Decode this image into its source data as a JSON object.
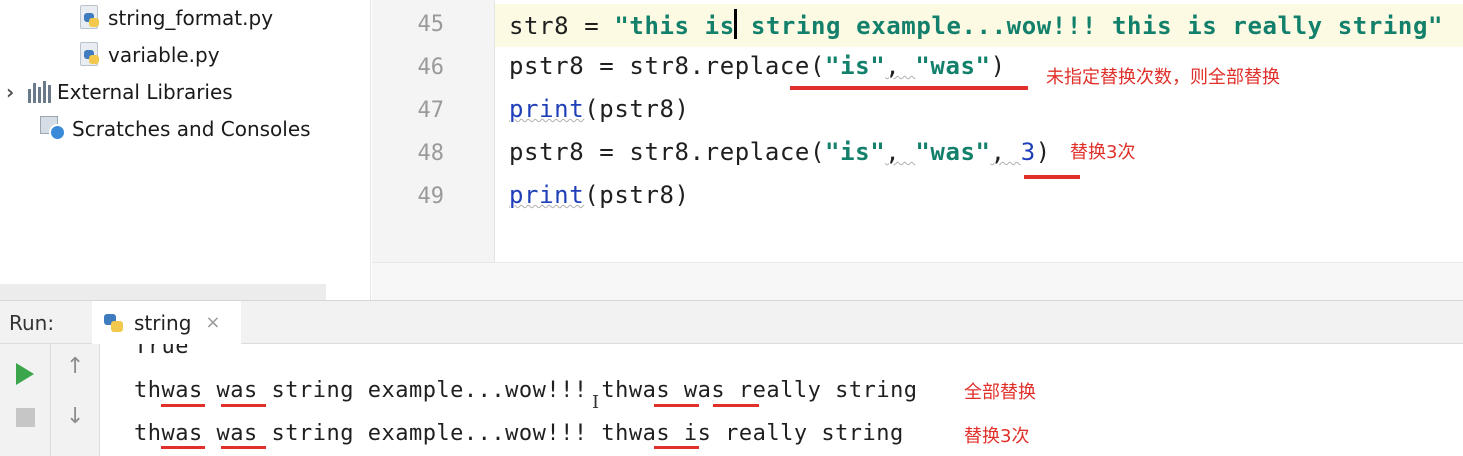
{
  "project_tree": {
    "items": [
      {
        "label": "string_format.py",
        "icon": "python-file-icon"
      },
      {
        "label": "variable.py",
        "icon": "python-file-icon"
      },
      {
        "label": "External Libraries",
        "icon": "library-icon",
        "expander": "›"
      },
      {
        "label": "Scratches and Consoles",
        "icon": "scratches-icon"
      }
    ]
  },
  "editor": {
    "line_numbers": [
      "45",
      "46",
      "47",
      "48",
      "49"
    ],
    "lines": {
      "l45": {
        "a": "str8 = ",
        "b": "\"this is",
        "c": " string example...wow!!! this is really string\""
      },
      "l46": {
        "a": "pstr8 = str8.replace(",
        "b": "\"is\"",
        "c": ", ",
        "d": "\"was\"",
        "e": ")"
      },
      "l47": {
        "a": "print",
        "b": "(pstr8)"
      },
      "l48": {
        "a": "pstr8 = str8.replace(",
        "b": "\"is\"",
        "c": ", ",
        "d": "\"was\"",
        "e": ", ",
        "f": "3",
        "g": ")"
      },
      "l49": {
        "a": "print",
        "b": "(pstr8)"
      }
    },
    "annotations": {
      "replace_all_note": "未指定替换次数，则全部替换",
      "replace_3_note": "替换3次"
    }
  },
  "run_panel": {
    "label": "Run:",
    "tab": {
      "label": "string",
      "close": "×"
    },
    "output": {
      "partial_line": "True",
      "line1": {
        "a": "th",
        "b": "was",
        "c": " ",
        "d": "was",
        "e": " string example...wow!!! th",
        "f": "was",
        "g": " ",
        "h": "was",
        "i": " really string"
      },
      "line2": {
        "a": "th",
        "b": "was",
        "c": " ",
        "d": "was",
        "e": " string example...wow!!! th",
        "f": "was",
        "g": " is really string"
      }
    },
    "annotations": {
      "all_replaced": "全部替换",
      "replaced_3": "替换3次"
    },
    "toolbar": {
      "up_arrow": "↑",
      "down_arrow": "↓"
    }
  },
  "colors": {
    "annotation_red": "#e0302a",
    "string_green": "#13806b",
    "builtin_blue": "#1f3fb8",
    "current_line": "#fdfae4"
  }
}
